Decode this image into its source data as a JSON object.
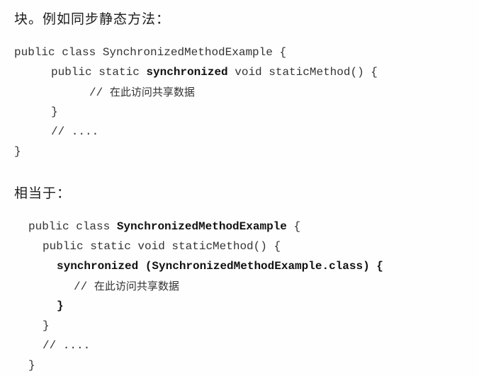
{
  "heading1": "块。例如同步静态方法：",
  "heading2": "相当于：",
  "code1": {
    "l1": "public class SynchronizedMethodExample {",
    "l2a": "public static ",
    "l2b": "synchronized",
    "l2c": " void staticMethod() {",
    "l3a": "// ",
    "l3b": "在此访问共享数据",
    "l4": "}",
    "l5": "// ....",
    "l6": "}"
  },
  "code2": {
    "l1a": "public class ",
    "l1b": "SynchronizedMethodExample",
    "l1c": " {",
    "l2": "public static void staticMethod() {",
    "l3": "synchronized (SynchronizedMethodExample.class) {",
    "l4a": "// ",
    "l4b": "在此访问共享数据",
    "l5": "}",
    "l6": "}",
    "l7": "// ....",
    "l8": "}"
  }
}
